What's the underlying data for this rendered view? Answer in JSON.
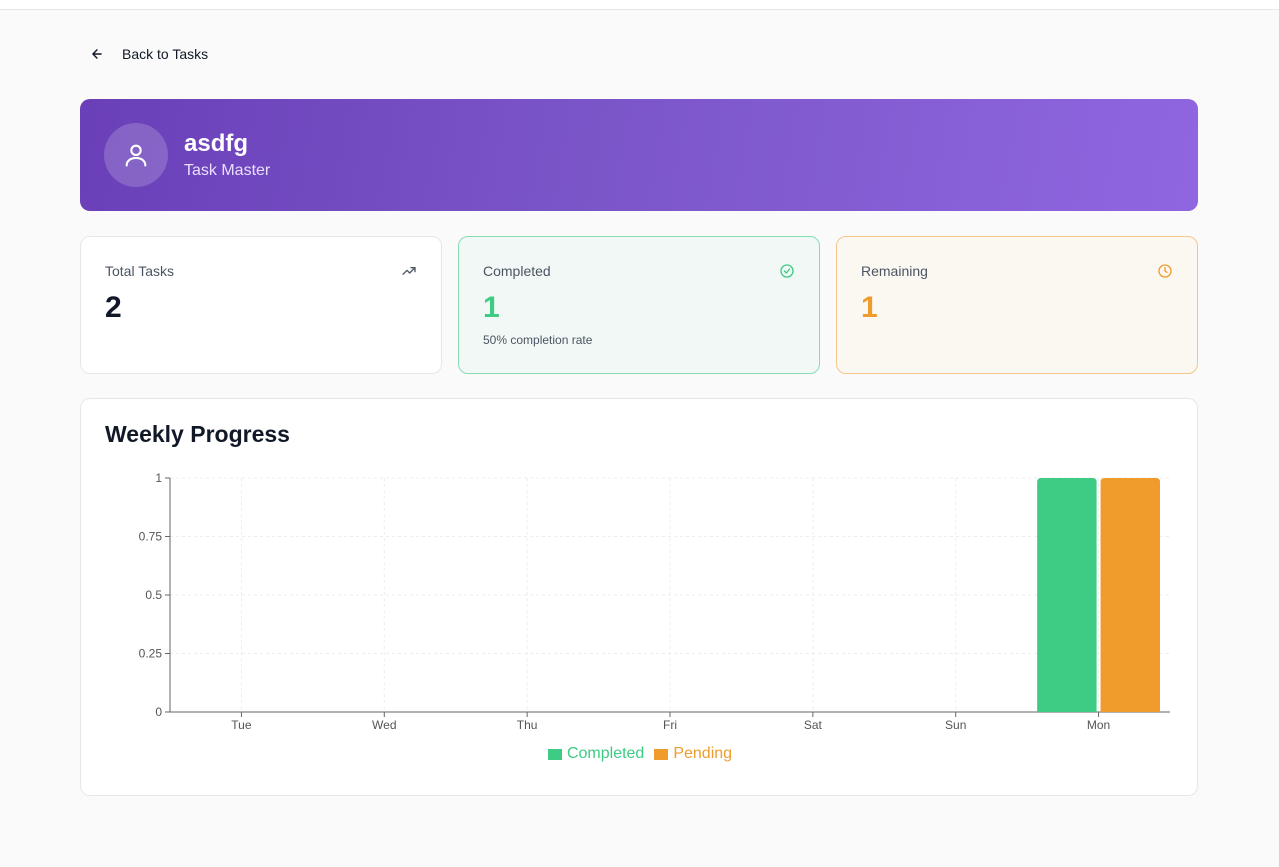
{
  "nav": {
    "back_label": "Back to Tasks"
  },
  "profile": {
    "name": "asdfg",
    "role": "Task Master"
  },
  "stats": {
    "total": {
      "label": "Total Tasks",
      "value": "2"
    },
    "completed": {
      "label": "Completed",
      "value": "1",
      "sub": "50% completion rate"
    },
    "remaining": {
      "label": "Remaining",
      "value": "1"
    }
  },
  "colors": {
    "accent": "#7a55c8",
    "completed": "#3ecb84",
    "pending": "#ef9c2d"
  },
  "chart": {
    "title": "Weekly Progress"
  },
  "chart_data": {
    "type": "bar",
    "title": "Weekly Progress",
    "categories": [
      "Tue",
      "Wed",
      "Thu",
      "Fri",
      "Sat",
      "Sun",
      "Mon"
    ],
    "series": [
      {
        "name": "Completed",
        "color": "#3ecb84",
        "values": [
          0,
          0,
          0,
          0,
          0,
          0,
          1
        ]
      },
      {
        "name": "Pending",
        "color": "#ef9c2d",
        "values": [
          0,
          0,
          0,
          0,
          0,
          0,
          1
        ]
      }
    ],
    "ylim": [
      0,
      1
    ],
    "yticks": [
      "0",
      "0.25",
      "0.5",
      "0.75",
      "1"
    ],
    "grid": true,
    "legend": "bottom-center"
  }
}
